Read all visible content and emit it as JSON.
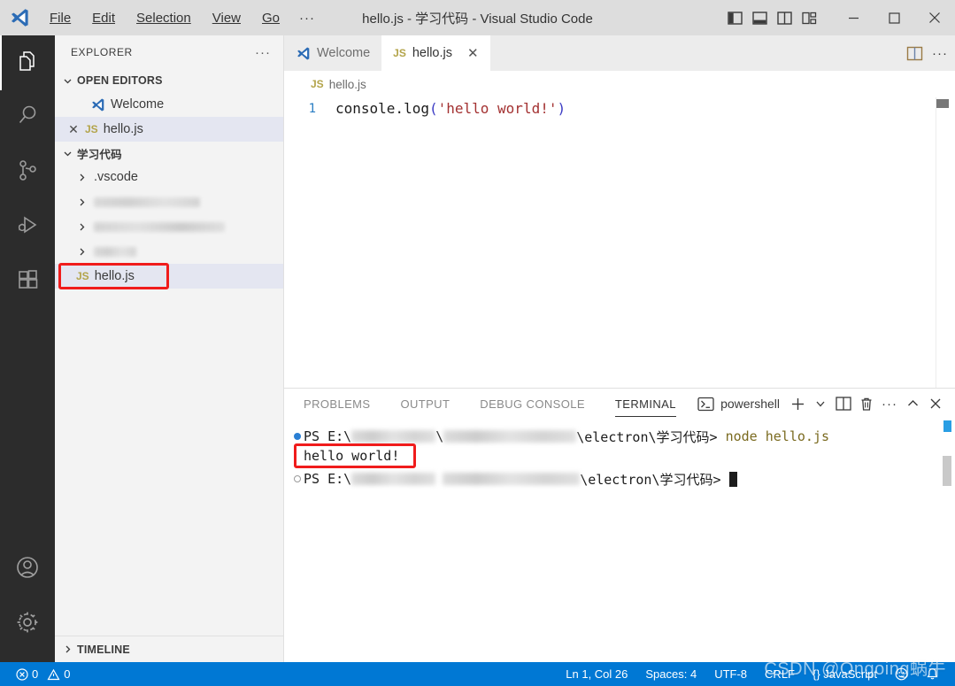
{
  "window": {
    "title": "hello.js - 学习代码 - Visual Studio Code",
    "menu": [
      "File",
      "Edit",
      "Selection",
      "View",
      "Go"
    ],
    "menu_more": "···",
    "layout_icons": [
      "toggle-primary-sidebar-icon",
      "toggle-panel-icon",
      "toggle-secondary-sidebar-icon",
      "customize-layout-icon"
    ],
    "controls": [
      "minimize-button",
      "maximize-button",
      "close-button"
    ]
  },
  "activitybar": {
    "items": [
      {
        "name": "explorer",
        "icon": "files-icon",
        "active": true
      },
      {
        "name": "search",
        "icon": "search-icon",
        "active": false
      },
      {
        "name": "source-control",
        "icon": "source-control-icon",
        "active": false
      },
      {
        "name": "run-and-debug",
        "icon": "run-debug-icon",
        "active": false
      },
      {
        "name": "extensions",
        "icon": "extensions-icon",
        "active": false
      }
    ],
    "bottom": [
      {
        "name": "accounts",
        "icon": "account-icon"
      },
      {
        "name": "settings",
        "icon": "gear-icon"
      }
    ]
  },
  "sidebar": {
    "header": {
      "title": "EXPLORER",
      "more": "···"
    },
    "open_editors": {
      "label": "OPEN EDITORS",
      "expanded": true,
      "items": [
        {
          "label": "Welcome",
          "icon": "vscode-icon",
          "selected": false,
          "has_close": false
        },
        {
          "label": "hello.js",
          "icon": "js-icon",
          "selected": true,
          "has_close": true,
          "close": "✕"
        }
      ]
    },
    "folder": {
      "label": "学习代码",
      "expanded": true,
      "items": [
        {
          "label": ".vscode",
          "type": "folder",
          "blurred": false,
          "expanded": false
        },
        {
          "label": "",
          "type": "folder",
          "blurred": true,
          "blur_width": 120,
          "expanded": false
        },
        {
          "label": "",
          "type": "folder",
          "blurred": true,
          "blur_width": 148,
          "expanded": false
        },
        {
          "label": "",
          "type": "folder",
          "blurred": true,
          "blur_width": 48,
          "expanded": false
        },
        {
          "label": "hello.js",
          "type": "file",
          "icon": "js-icon",
          "blurred": false,
          "selected": true,
          "annotated": true
        }
      ]
    },
    "timeline": {
      "label": "TIMELINE",
      "expanded": false
    }
  },
  "editor": {
    "tabs": [
      {
        "label": "Welcome",
        "icon": "vscode-icon",
        "active": false,
        "closable": false
      },
      {
        "label": "hello.js",
        "icon": "js-icon",
        "active": true,
        "closable": true,
        "close": "✕"
      }
    ],
    "actions": [
      "split-editor-icon",
      "more-actions-icon"
    ],
    "breadcrumb": {
      "icon": "js-icon",
      "label": "hello.js"
    },
    "lines": [
      {
        "number": "1",
        "tokens": [
          {
            "text": "console.log",
            "type": "plain"
          },
          {
            "text": "(",
            "type": "paren"
          },
          {
            "text": "'hello world!'",
            "type": "string"
          },
          {
            "text": ")",
            "type": "paren"
          }
        ]
      }
    ]
  },
  "panel": {
    "tabs": [
      {
        "label": "PROBLEMS",
        "active": false
      },
      {
        "label": "OUTPUT",
        "active": false
      },
      {
        "label": "DEBUG CONSOLE",
        "active": false
      },
      {
        "label": "TERMINAL",
        "active": true
      }
    ],
    "shell": {
      "icon": "terminal-powershell-icon",
      "label": "powershell"
    },
    "actions": [
      "new-terminal-icon",
      "terminal-dropdown-icon",
      "split-terminal-icon",
      "kill-terminal-icon",
      "terminal-more-icon",
      "maximize-panel-icon",
      "close-panel-icon"
    ],
    "terminal_lines": [
      {
        "marker": "filled",
        "prefix": "PS E:\\",
        "blur1_width": 95,
        "mid": "\\",
        "blur2_width": 150,
        "path_tail": "\\electron\\学习代码> ",
        "command": "node hello.js",
        "annotated": false
      },
      {
        "marker": "none",
        "output": "hello world!",
        "annotated": true
      },
      {
        "marker": "hollow",
        "prefix": "PS E:\\",
        "blur1_width": 95,
        "mid": "",
        "blur2_width": 155,
        "path_tail": "\\electron\\学习代码> ",
        "command": "",
        "cursor": true,
        "annotated": false
      }
    ]
  },
  "statusbar": {
    "left": [
      {
        "name": "errors",
        "icon": "error-icon",
        "value": "0"
      },
      {
        "name": "warnings",
        "icon": "warning-icon",
        "value": "0"
      }
    ],
    "right": [
      {
        "name": "cursor-position",
        "label": "Ln 1, Col 26"
      },
      {
        "name": "indentation",
        "label": "Spaces: 4"
      },
      {
        "name": "encoding",
        "label": "UTF-8"
      },
      {
        "name": "eol",
        "label": "CRLF"
      },
      {
        "name": "language-mode",
        "label": "{} JavaScript"
      },
      {
        "name": "feedback",
        "label": "☺"
      },
      {
        "name": "notifications",
        "label": "🔔"
      }
    ],
    "background": "#0078d4"
  },
  "watermark": {
    "text": "CSDN @Ongoing蜗牛"
  },
  "annotation": {
    "color": "#f01c1c"
  }
}
